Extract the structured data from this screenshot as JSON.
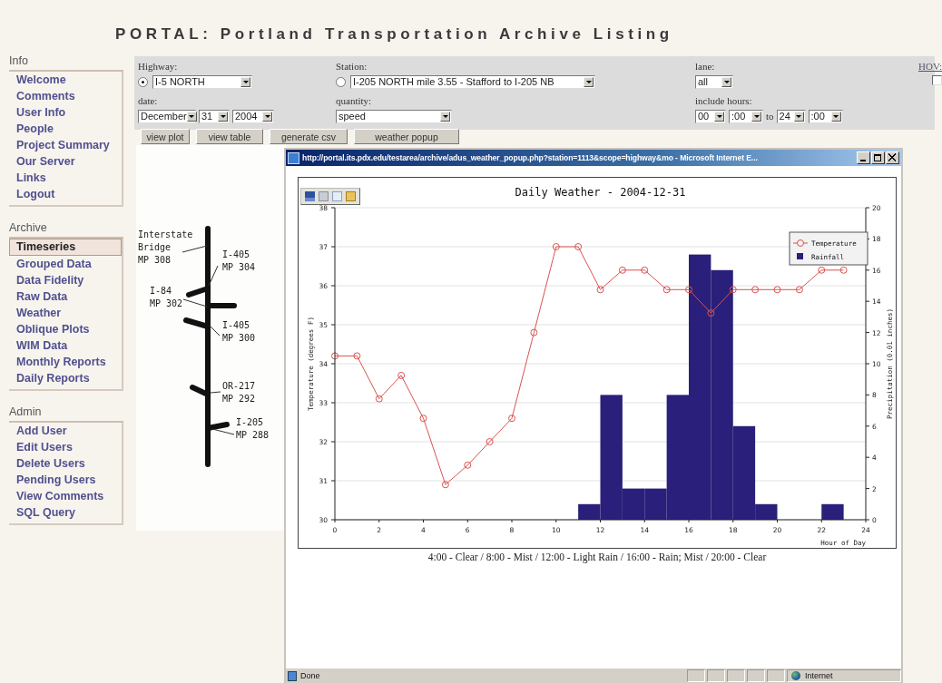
{
  "page_title": "PORTAL: Portland Transportation Archive Listing",
  "sidebar": {
    "sections": [
      {
        "heading": "Info",
        "items": [
          {
            "label": "Welcome",
            "selected": false
          },
          {
            "label": "Comments",
            "selected": false
          },
          {
            "label": "User Info",
            "selected": false
          },
          {
            "label": "People",
            "selected": false
          },
          {
            "label": "Project Summary",
            "selected": false
          },
          {
            "label": "Our Server",
            "selected": false
          },
          {
            "label": "Links",
            "selected": false
          },
          {
            "label": "Logout",
            "selected": false
          }
        ]
      },
      {
        "heading": "Archive",
        "items": [
          {
            "label": "Timeseries",
            "selected": true
          },
          {
            "label": "Grouped Data",
            "selected": false
          },
          {
            "label": "Data Fidelity",
            "selected": false
          },
          {
            "label": "Raw Data",
            "selected": false
          },
          {
            "label": "Weather",
            "selected": false
          },
          {
            "label": "Oblique Plots",
            "selected": false
          },
          {
            "label": "WIM Data",
            "selected": false
          },
          {
            "label": "Monthly Reports",
            "selected": false
          },
          {
            "label": "Daily Reports",
            "selected": false
          }
        ]
      },
      {
        "heading": "Admin",
        "items": [
          {
            "label": "Add User",
            "selected": false
          },
          {
            "label": "Edit Users",
            "selected": false
          },
          {
            "label": "Delete Users",
            "selected": false
          },
          {
            "label": "Pending Users",
            "selected": false
          },
          {
            "label": "View Comments",
            "selected": false
          },
          {
            "label": "SQL Query",
            "selected": false
          }
        ]
      }
    ]
  },
  "form": {
    "highway": {
      "label": "Highway:",
      "selected": true,
      "value": "I-5 NORTH"
    },
    "station": {
      "label": "Station:",
      "selected": false,
      "value": "I-205 NORTH mile 3.55 - Stafford to I-205 NB"
    },
    "lane": {
      "label": "lane:",
      "value": "all"
    },
    "hov": {
      "label": "HOV:",
      "checked": false
    },
    "date": {
      "label": "date:",
      "month": "December",
      "day": "31",
      "year": "2004"
    },
    "quantity": {
      "label": "quantity:",
      "value": "speed"
    },
    "hours": {
      "label": "include hours:",
      "from_hour": "00",
      "from_minute": ":00",
      "separator": "to",
      "to_hour": "24",
      "to_minute": ":00"
    }
  },
  "buttons": [
    "view plot",
    "view table",
    "generate csv",
    "weather popup"
  ],
  "highway_map": {
    "labels": [
      {
        "lines": [
          "Interstate",
          "Bridge",
          "MP 308"
        ]
      },
      {
        "lines": [
          "I-405",
          "MP 304"
        ]
      },
      {
        "lines": [
          "I-84",
          "MP 302"
        ]
      },
      {
        "lines": [
          "I-405",
          "MP 300"
        ]
      },
      {
        "lines": [
          "OR-217",
          "MP 292"
        ]
      },
      {
        "lines": [
          "I-205",
          "MP 288"
        ]
      }
    ]
  },
  "popup": {
    "title": "http://portal.its.pdx.edu/testarea/archive/adus_weather_popup.php?station=1113&scope=highway&mo - Microsoft Internet E...",
    "chart_data": {
      "type": "bar",
      "title": "Daily Weather - 2004-12-31",
      "xlabel": "Hour of Day",
      "ylabel": "Temperature (degrees F)",
      "y2label": "Precipitation (0.01 inches)",
      "x": [
        0,
        1,
        2,
        3,
        4,
        5,
        6,
        7,
        8,
        9,
        10,
        11,
        12,
        13,
        14,
        15,
        16,
        17,
        18,
        19,
        20,
        21,
        22,
        23
      ],
      "xlim": [
        0,
        24
      ],
      "ylim": [
        30,
        38
      ],
      "y2lim": [
        0,
        20
      ],
      "xticks": [
        0,
        2,
        4,
        6,
        8,
        10,
        12,
        14,
        16,
        18,
        20,
        22,
        24
      ],
      "yticks": [
        30,
        31,
        32,
        33,
        34,
        35,
        36,
        37,
        38
      ],
      "grid": true,
      "y2ticks": [
        0,
        2,
        4,
        6,
        8,
        10,
        12,
        14,
        16,
        18,
        20
      ],
      "series": [
        {
          "name": "Temperature",
          "color": "#d9534f",
          "type": "line",
          "marker": "circle",
          "values": [
            34.2,
            34.2,
            33.1,
            33.7,
            32.6,
            30.9,
            31.4,
            32.0,
            32.6,
            34.8,
            37.0,
            37.0,
            35.9,
            36.4,
            36.4,
            35.9,
            35.9,
            35.3,
            35.9,
            35.9,
            35.9,
            35.9,
            36.4,
            36.4
          ]
        },
        {
          "name": "Rainfall",
          "color": "#2a1f7a",
          "axis": "y2",
          "x": [
            11.5,
            12.5,
            13.5,
            14.5,
            15.5,
            16.5,
            17.5,
            18.5,
            19.5,
            22.5
          ],
          "values": [
            1,
            8,
            2,
            2,
            8,
            17,
            16,
            6,
            1,
            1
          ]
        }
      ],
      "legend": "top right"
    },
    "caption": "4:00 - Clear / 8:00 - Mist / 12:00 - Light Rain / 16:00 - Rain; Mist / 20:00 - Clear",
    "status": {
      "text": "Done",
      "zone": "Internet"
    }
  }
}
